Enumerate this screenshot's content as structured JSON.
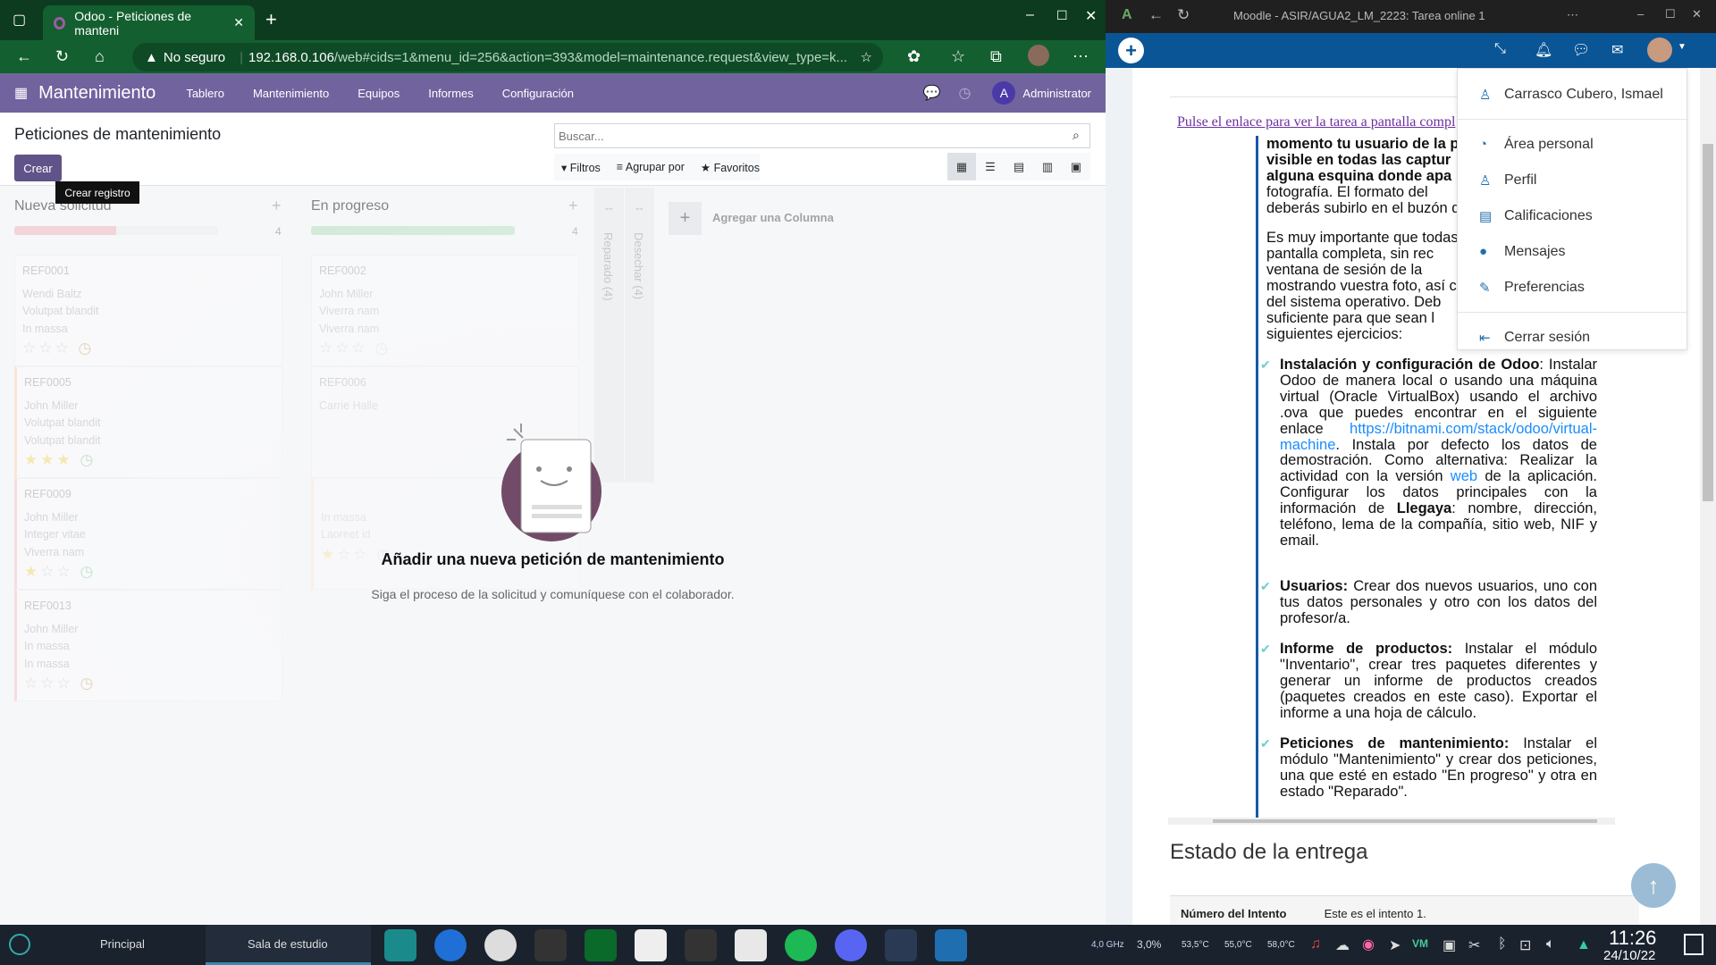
{
  "left_browser": {
    "tab_title": "Odoo - Peticiones de manteni",
    "security": "No seguro",
    "url_host": "192.168.0.106",
    "url_path": "/web#cids=1&menu_id=256&action=393&model=maintenance.request&view_type=k..."
  },
  "odoo": {
    "app_name": "Mantenimiento",
    "menu": [
      "Tablero",
      "Mantenimiento",
      "Equipos",
      "Informes",
      "Configuración"
    ],
    "user_initial": "A",
    "user": "Administrator",
    "page_title": "Peticiones de mantenimiento",
    "search_placeholder": "Buscar...",
    "create_label": "Crear",
    "tooltip": "Crear registro",
    "filters": "Filtros",
    "group_by": "Agrupar por",
    "favorites": "Favoritos",
    "columns": [
      {
        "title": "Nueva solicitud",
        "count": "4",
        "progress_pct": 50,
        "bar_color": "#f0b8bf",
        "cards": [
          {
            "ref": "REF0001",
            "lines": [
              "Wendi Baltz",
              "Volutpat blandit",
              "In massa"
            ],
            "stars": 0,
            "clock": "#d6b27a",
            "border": ""
          },
          {
            "ref": "REF0005",
            "lines": [
              "John Miller",
              "Volutpat blandit",
              "Volutpat blandit"
            ],
            "stars": 3,
            "clock": "#8fd3a0",
            "border": "#fcd9b8"
          },
          {
            "ref": "REF0009",
            "lines": [
              "John Miller",
              "Integer vitae",
              "Viverra nam"
            ],
            "stars": 1,
            "clock": "#8fd3a0",
            "border": "#f5c8c8"
          },
          {
            "ref": "REF0013",
            "lines": [
              "John Miller",
              "In massa",
              "In massa"
            ],
            "stars": 0,
            "clock": "#d6b27a",
            "border": "#f5c8c8"
          }
        ]
      },
      {
        "title": "En progreso",
        "count": "4",
        "progress_pct": 100,
        "bar_color": "#b6e0c0",
        "cards": [
          {
            "ref": "REF0002",
            "lines": [
              "John Miller",
              "Viverra nam",
              "Viverra nam"
            ],
            "stars": 0,
            "clock": "#cde8d4",
            "border": ""
          },
          {
            "ref": "REF0006",
            "lines": [
              "Carrie Halle",
              "",
              ""
            ],
            "stars": 0,
            "clock": "",
            "border": ""
          },
          {
            "ref": "",
            "lines": [
              "",
              "In massa",
              "Laoreet id"
            ],
            "stars": 1,
            "clock": "#f3c4c4",
            "border": "#fde3cc"
          }
        ]
      }
    ],
    "folded": [
      "Reparado (4)",
      "Desechar (4)"
    ],
    "add_column": "Agregar una Columna",
    "empty_title": "Añadir una nueva petición de mantenimiento",
    "empty_subtitle": "Siga el proceso de la solicitud y comuníquese con el colaborador."
  },
  "right_browser": {
    "title": "Moodle - ASIR/AGUA2_LM_2223: Tarea online 1",
    "link": "Pulse el enlace para ver la tarea a pantalla compl",
    "para1": [
      "momento tu usuario de la p",
      "visible en todas las captur",
      "alguna esquina donde apa",
      "fotografía. El formato del",
      "deberás subirlo en el buzón de"
    ],
    "para2": [
      "Es muy importante que todas",
      "pantalla completa, sin rec",
      "ventana de sesión de la",
      "mostrando vuestra foto, así c",
      "del sistema operativo. Deb",
      "suficiente para que sean l",
      "siguientes ejercicios:"
    ],
    "items": [
      {
        "bold": "Instalación y configuración de Odoo",
        "pre": ": Instalar Odoo de manera local o usando una máquina virtual (Oracle VirtualBox) usando el archivo .ova que puedes encontrar en el siguiente enlace ",
        "link": "https://bitnami.com/stack/odoo/virtual-machine",
        "mid": ". Instala por defecto los datos de demostración. Como alternativa: Realizar la actividad con la versión ",
        "link2": "web ",
        "post": " de la aplicación. Configurar los datos principales con la información de ",
        "bold2": "Llegaya",
        "tail": ": nombre, dirección, teléfono, lema de la compañía, sitio web, NIF y email."
      },
      {
        "bold": "Usuarios:",
        "text": " Crear dos nuevos usuarios, uno con tus datos personales y otro con los datos del profesor/a."
      },
      {
        "bold": "Informe de productos:",
        "text": " Instalar el módulo \"Inventario\", crear tres paquetes diferentes y generar un informe de productos creados (paquetes creados en este caso). Exportar el informe a una hoja de cálculo."
      },
      {
        "bold": "Peticiones de mantenimiento:",
        "text": " Instalar el módulo \"Mantenimiento\" y crear dos peticiones, una que esté en estado \"En progreso\" y otra en estado \"Reparado\"."
      }
    ],
    "section_title": "Estado de la entrega",
    "row_label": "Número del Intento",
    "row_value": "Este es el intento 1.",
    "user_menu": {
      "name": "Carrasco Cubero, Ismael",
      "items": [
        "Área personal",
        "Perfil",
        "Calificaciones",
        "Mensajes",
        "Preferencias"
      ],
      "logout": "Cerrar sesión"
    }
  },
  "taskbar": {
    "workspaces": [
      "Principal",
      "Sala de estudio"
    ],
    "apps": [
      "files",
      "edge",
      "vmware",
      "notes",
      "andalucia",
      "image",
      "font",
      "archive",
      "spotify",
      "discord",
      "vscode",
      "monitor"
    ],
    "stats": [
      "4,0 GHz",
      "3,0%",
      "53,5°C",
      "55,0°C",
      "58,0°C"
    ],
    "time": "11:26",
    "date": "24/10/22"
  }
}
